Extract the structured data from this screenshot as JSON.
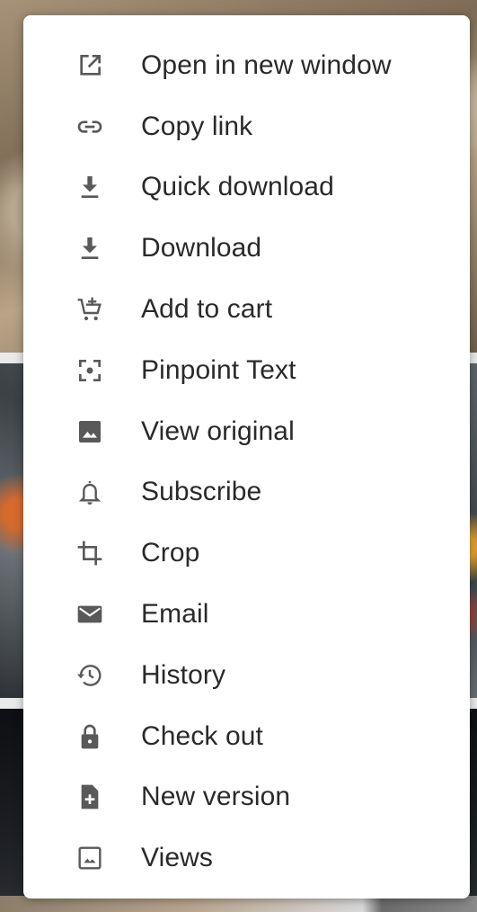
{
  "menu": {
    "items": [
      {
        "label": "Open in new window",
        "icon": "open-in-new-icon"
      },
      {
        "label": "Copy link",
        "icon": "link-icon"
      },
      {
        "label": "Quick download",
        "icon": "download-icon"
      },
      {
        "label": "Download",
        "icon": "download-icon"
      },
      {
        "label": "Add to cart",
        "icon": "add-cart-icon"
      },
      {
        "label": "Pinpoint Text",
        "icon": "pinpoint-icon"
      },
      {
        "label": "View original",
        "icon": "image-icon"
      },
      {
        "label": "Subscribe",
        "icon": "bell-icon"
      },
      {
        "label": "Crop",
        "icon": "crop-icon"
      },
      {
        "label": "Email",
        "icon": "email-icon"
      },
      {
        "label": "History",
        "icon": "history-icon"
      },
      {
        "label": "Check out",
        "icon": "lock-icon"
      },
      {
        "label": "New version",
        "icon": "new-file-icon"
      },
      {
        "label": "Views",
        "icon": "image-outline-icon"
      }
    ]
  },
  "colors": {
    "icon": "#595959",
    "label": "#2a2a2a",
    "menu_background": "#ffffff"
  }
}
